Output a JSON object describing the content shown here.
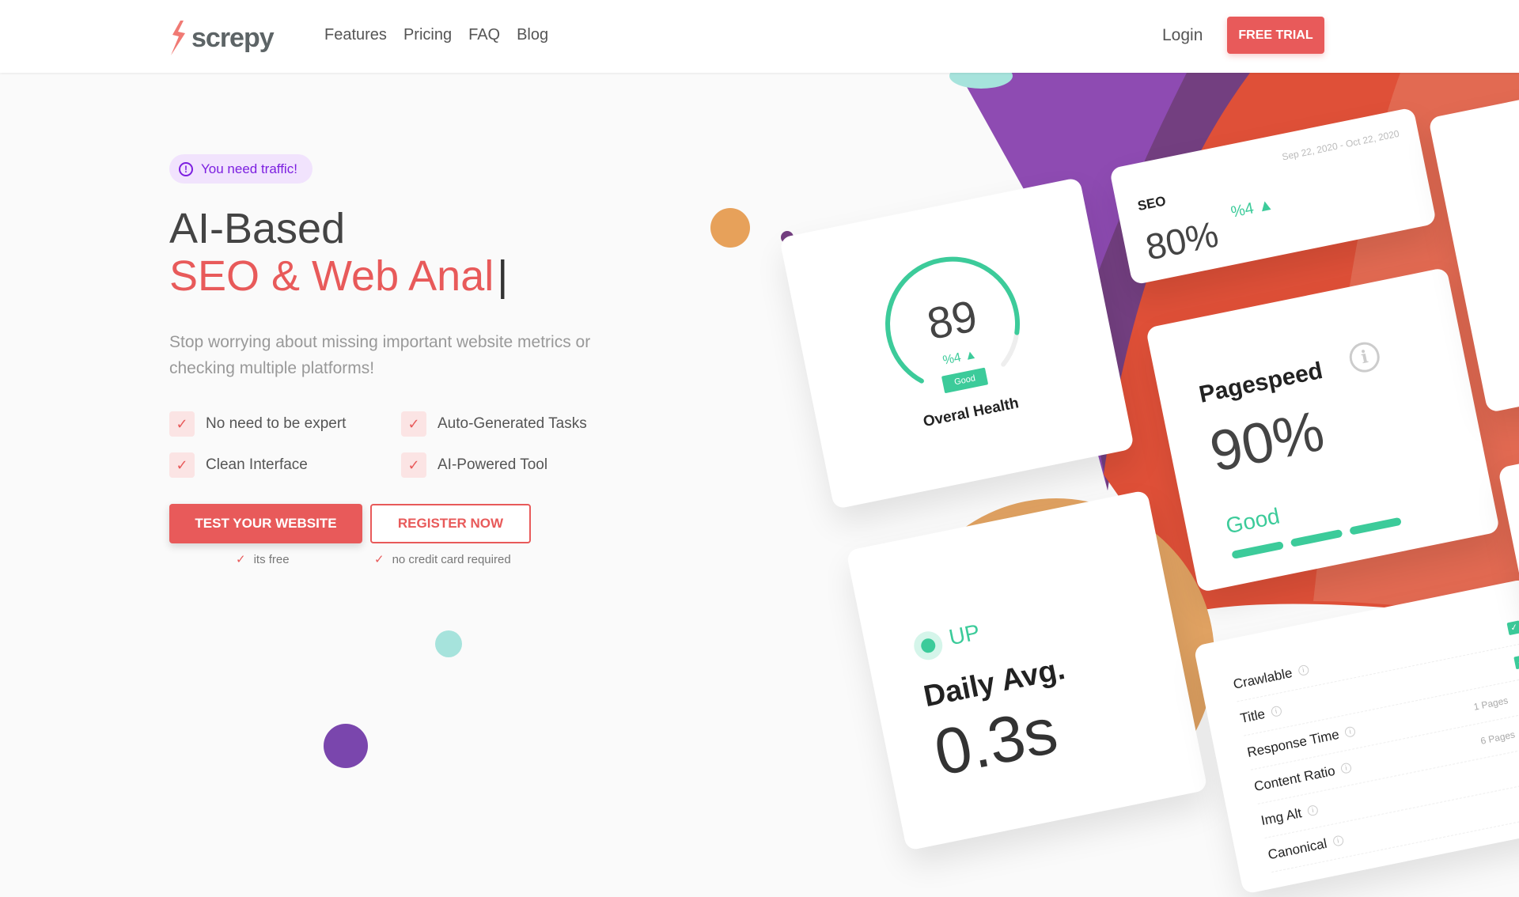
{
  "brand": {
    "name": "screpy",
    "color": "#e85a5a"
  },
  "nav": {
    "items": [
      "Features",
      "Pricing",
      "FAQ",
      "Blog"
    ],
    "login": "Login",
    "free_trial": "FREE TRIAL"
  },
  "hero": {
    "badge": "You need traffic!",
    "title_line1": "AI-Based",
    "title_line2": "SEO & Web Anal",
    "caret": "|",
    "lead": "Stop worrying about missing important website metrics or checking multiple platforms!",
    "features": [
      "No need to be expert",
      "Auto-Generated Tasks",
      "Clean Interface",
      "AI-Powered Tool"
    ],
    "cta_primary": "TEST YOUR WEBSITE",
    "cta_secondary": "REGISTER NOW",
    "note_primary": "its free",
    "note_secondary": "no credit card required"
  },
  "dashboard": {
    "health": {
      "value": "89",
      "change": "%4 ▲",
      "status": "Good",
      "label": "Overal Health",
      "gauge_fraction": 0.89
    },
    "seo": {
      "label": "SEO",
      "date_range": "Sep 22, 2020 - Oct 22, 2020",
      "value": "80%",
      "change": "%4 ▲"
    },
    "pagespeed": {
      "label": "Pagespeed",
      "value": "90%",
      "status": "Good"
    },
    "uptime": {
      "status": "UP",
      "label": "Daily Avg.",
      "value": "0.3s"
    },
    "checks": [
      {
        "label": "Crawlable",
        "value": "",
        "ok": true
      },
      {
        "label": "Title",
        "value": "",
        "ok": true
      },
      {
        "label": "Response Time",
        "value": "1 Pages",
        "ok": false
      },
      {
        "label": "Content Ratio",
        "value": "6 Pages",
        "ok": false
      },
      {
        "label": "Img Alt",
        "value": "",
        "ok": true
      },
      {
        "label": "Canonical",
        "value": "",
        "ok": true
      }
    ]
  },
  "colors": {
    "accent": "#e85a5a",
    "good": "#3ccb9a",
    "badge": "#7c1fe0",
    "purple": "#8e4bb2",
    "orange": "#e7a15a",
    "teal": "#a6e3dc"
  }
}
